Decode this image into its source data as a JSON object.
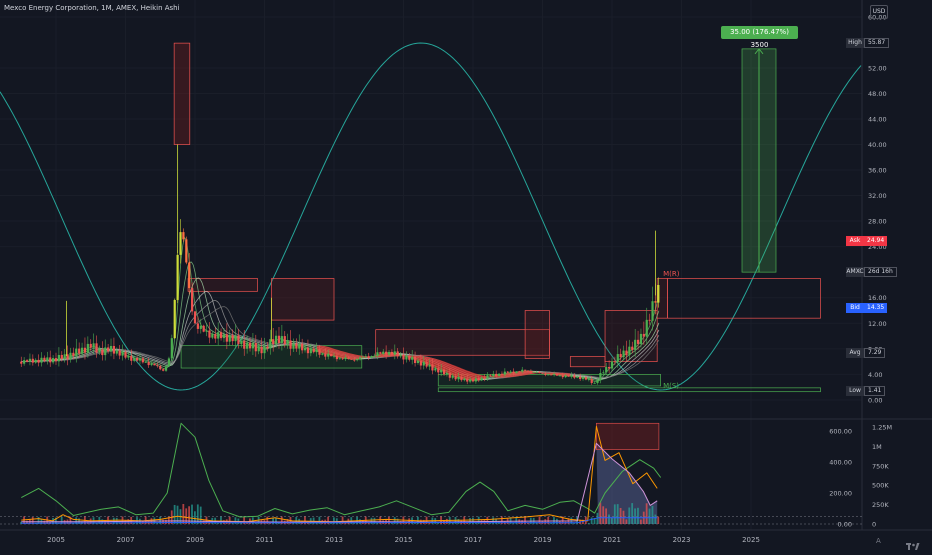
{
  "header": {
    "symbol_line": "Mexco Energy Corporation, 1M, AMEX, Heikin Ashi",
    "currency": "USD"
  },
  "price_axis": {
    "ticks": [
      {
        "label": "60.00",
        "value": 60
      },
      {
        "label": "52.00",
        "value": 52
      },
      {
        "label": "48.00",
        "value": 48
      },
      {
        "label": "44.00",
        "value": 44
      },
      {
        "label": "40.00",
        "value": 40
      },
      {
        "label": "36.00",
        "value": 36
      },
      {
        "label": "32.00",
        "value": 32
      },
      {
        "label": "28.00",
        "value": 28
      },
      {
        "label": "24.00",
        "value": 24
      },
      {
        "label": "16.00",
        "value": 16
      },
      {
        "label": "12.00",
        "value": 12
      },
      {
        "label": "8.00",
        "value": 8
      },
      {
        "label": "4.00",
        "value": 4
      },
      {
        "label": "0.00",
        "value": 0
      }
    ]
  },
  "price_tags": [
    {
      "key": "High",
      "value": "55.87",
      "price": 55.87,
      "bg": "#131722",
      "fg": "#d1d4dc",
      "keybg": "#2a2e39"
    },
    {
      "key": "Ask",
      "value": "24.94",
      "price": 24.94,
      "bg": "#f23645",
      "fg": "#ffffff",
      "keybg": "#f23645"
    },
    {
      "key": "AMXC",
      "value": "26d 16h",
      "price": 20,
      "bg": "#131722",
      "fg": "#d1d4dc",
      "keybg": "#2a2e39"
    },
    {
      "key": "Bid",
      "value": "14.35",
      "price": 14.35,
      "bg": "#2962ff",
      "fg": "#ffffff",
      "keybg": "#2962ff"
    },
    {
      "key": "Avg",
      "value": "7.29",
      "price": 7.29,
      "bg": "#131722",
      "fg": "#d1d4dc",
      "keybg": "#2a2e39"
    },
    {
      "key": "Low",
      "value": "1.41",
      "price": 1.41,
      "bg": "#131722",
      "fg": "#d1d4dc",
      "keybg": "#2a2e39"
    }
  ],
  "measure": {
    "label": "35.00 (176.47%) 3500",
    "from": 20,
    "to": 55
  },
  "annotations": [
    {
      "text": "M(R)",
      "price": 19,
      "year": 2022.7
    },
    {
      "text": "M(S)",
      "price": 1.6,
      "year": 2022.7
    }
  ],
  "indicator_axis": {
    "left_ticks": [
      {
        "label": "600.00",
        "value": 600
      },
      {
        "label": "400.00",
        "value": 400
      },
      {
        "label": "200.00",
        "value": 200
      },
      {
        "label": "0.00",
        "value": 0
      }
    ],
    "right_ticks": [
      {
        "label": "1.25M",
        "value": 1250
      },
      {
        "label": "1M",
        "value": 1000
      },
      {
        "label": "750K",
        "value": 750
      },
      {
        "label": "500K",
        "value": 500
      },
      {
        "label": "250K",
        "value": 250
      },
      {
        "label": "0",
        "value": 0
      }
    ]
  },
  "time_axis": {
    "ticks": [
      {
        "label": "2005",
        "year": 2005
      },
      {
        "label": "2007",
        "year": 2007
      },
      {
        "label": "2009",
        "year": 2009
      },
      {
        "label": "2011",
        "year": 2011
      },
      {
        "label": "2013",
        "year": 2013
      },
      {
        "label": "2015",
        "year": 2015
      },
      {
        "label": "2017",
        "year": 2017
      },
      {
        "label": "2019",
        "year": 2019
      },
      {
        "label": "2021",
        "year": 2021
      },
      {
        "label": "2023",
        "year": 2023
      },
      {
        "label": "2025",
        "year": 2025
      }
    ]
  },
  "bottom_buttons": {
    "auto": "A",
    "theme": "tradingview"
  },
  "colors": {
    "bg": "#131722",
    "up": "#26a69a",
    "down": "#ef5350",
    "green": "#4caf50",
    "grid": "#1e222d"
  },
  "chart_data": [
    {
      "type": "candlestick",
      "title": "Mexco Energy Corporation, 1M, AMEX, Heikin Ashi",
      "y_range": [
        0,
        60
      ],
      "x_range": [
        2004,
        2026
      ],
      "series": [
        {
          "points": [
            [
              2004.0,
              6.0
            ],
            [
              2004.5,
              6.2
            ],
            [
              2005.0,
              6.4
            ],
            [
              2005.5,
              7.2
            ],
            [
              2006.0,
              8.5
            ],
            [
              2006.3,
              7.5
            ],
            [
              2006.6,
              8.0
            ],
            [
              2007.0,
              6.8
            ],
            [
              2007.4,
              6.2
            ],
            [
              2007.8,
              5.5
            ],
            [
              2008.1,
              4.6
            ],
            [
              2008.3,
              7.0
            ],
            [
              2008.45,
              18.0
            ],
            [
              2008.55,
              28.0
            ],
            [
              2008.7,
              24.0
            ],
            [
              2008.85,
              16.0
            ],
            [
              2009.0,
              12.0
            ],
            [
              2009.3,
              10.5
            ],
            [
              2009.6,
              10.0
            ],
            [
              2010.0,
              9.8
            ],
            [
              2010.5,
              8.5
            ],
            [
              2011.0,
              7.8
            ],
            [
              2011.3,
              9.8
            ],
            [
              2011.6,
              9.0
            ],
            [
              2012.0,
              8.2
            ],
            [
              2012.5,
              7.5
            ],
            [
              2013.0,
              6.7
            ],
            [
              2013.5,
              6.3
            ],
            [
              2014.0,
              6.8
            ],
            [
              2014.5,
              7.5
            ],
            [
              2015.0,
              6.8
            ],
            [
              2015.5,
              5.8
            ],
            [
              2016.0,
              4.6
            ],
            [
              2016.5,
              3.4
            ],
            [
              2017.0,
              3.0
            ],
            [
              2017.5,
              3.8
            ],
            [
              2018.0,
              4.3
            ],
            [
              2018.5,
              4.6
            ],
            [
              2019.0,
              4.1
            ],
            [
              2019.5,
              3.8
            ],
            [
              2020.0,
              3.6
            ],
            [
              2020.3,
              3.2
            ],
            [
              2020.5,
              2.6
            ],
            [
              2020.7,
              4.2
            ],
            [
              2021.0,
              5.8
            ],
            [
              2021.3,
              7.3
            ],
            [
              2021.6,
              8.2
            ],
            [
              2021.9,
              10.5
            ],
            [
              2022.1,
              13.0
            ],
            [
              2022.3,
              17.5
            ]
          ],
          "highs": [
            [
              2008.5,
              40.0
            ],
            [
              2022.25,
              26.5
            ],
            [
              2005.3,
              15.5
            ],
            [
              2011.2,
              16.0
            ]
          ],
          "lows": [
            [
              2016.0,
              1.41
            ]
          ]
        }
      ],
      "ranges": [
        {
          "label": "High",
          "value": 55.87
        },
        {
          "label": "Low",
          "value": 1.41
        },
        {
          "label": "Avg",
          "value": 7.29
        }
      ]
    },
    {
      "type": "line",
      "title": "",
      "y_range": [
        0,
        660
      ],
      "x_range": [
        2004,
        2026
      ],
      "series": [
        {
          "color": "#4caf50",
          "points": [
            [
              2004.0,
              170
            ],
            [
              2004.5,
              230
            ],
            [
              2005.0,
              150
            ],
            [
              2005.5,
              55
            ],
            [
              2006.3,
              95
            ],
            [
              2006.8,
              110
            ],
            [
              2007.3,
              60
            ],
            [
              2007.8,
              70
            ],
            [
              2008.2,
              200
            ],
            [
              2008.6,
              650
            ],
            [
              2009.0,
              560
            ],
            [
              2009.4,
              280
            ],
            [
              2009.8,
              85
            ],
            [
              2010.3,
              45
            ],
            [
              2010.8,
              50
            ],
            [
              2011.3,
              100
            ],
            [
              2011.8,
              65
            ],
            [
              2012.3,
              90
            ],
            [
              2012.8,
              105
            ],
            [
              2013.3,
              60
            ],
            [
              2013.8,
              85
            ],
            [
              2014.3,
              110
            ],
            [
              2014.8,
              150
            ],
            [
              2015.3,
              105
            ],
            [
              2015.8,
              60
            ],
            [
              2016.3,
              75
            ],
            [
              2016.8,
              210
            ],
            [
              2017.2,
              270
            ],
            [
              2017.6,
              210
            ],
            [
              2018.0,
              85
            ],
            [
              2018.5,
              120
            ],
            [
              2019.0,
              95
            ],
            [
              2019.5,
              140
            ],
            [
              2019.9,
              150
            ],
            [
              2020.3,
              100
            ],
            [
              2020.5,
              70
            ],
            [
              2020.8,
              200
            ],
            [
              2021.3,
              340
            ],
            [
              2021.8,
              415
            ],
            [
              2022.2,
              360
            ],
            [
              2022.4,
              300
            ]
          ]
        },
        {
          "color": "#ff9800",
          "points": [
            [
              2004.0,
              25
            ],
            [
              2004.5,
              35
            ],
            [
              2004.9,
              20
            ],
            [
              2005.2,
              60
            ],
            [
              2005.5,
              30
            ],
            [
              2006.0,
              20
            ],
            [
              2006.8,
              25
            ],
            [
              2007.5,
              20
            ],
            [
              2008.0,
              30
            ],
            [
              2008.5,
              50
            ],
            [
              2009.0,
              35
            ],
            [
              2009.5,
              20
            ],
            [
              2010.5,
              15
            ],
            [
              2011.3,
              40
            ],
            [
              2011.8,
              20
            ],
            [
              2013.0,
              15
            ],
            [
              2014.5,
              30
            ],
            [
              2015.5,
              20
            ],
            [
              2016.8,
              25
            ],
            [
              2017.5,
              30
            ],
            [
              2018.5,
              45
            ],
            [
              2019.2,
              60
            ],
            [
              2019.8,
              30
            ],
            [
              2020.3,
              20
            ],
            [
              2020.55,
              630
            ],
            [
              2020.8,
              410
            ],
            [
              2021.2,
              460
            ],
            [
              2021.6,
              260
            ],
            [
              2022.0,
              330
            ],
            [
              2022.3,
              230
            ]
          ]
        },
        {
          "color": "#ce93d8",
          "points": [
            [
              2004.0,
              15
            ],
            [
              2006.0,
              15
            ],
            [
              2008.5,
              20
            ],
            [
              2010.0,
              15
            ],
            [
              2012.0,
              12
            ],
            [
              2014.0,
              15
            ],
            [
              2016.0,
              12
            ],
            [
              2018.0,
              18
            ],
            [
              2020.0,
              20
            ],
            [
              2020.55,
              520
            ],
            [
              2021.0,
              420
            ],
            [
              2021.5,
              330
            ],
            [
              2021.9,
              210
            ],
            [
              2022.1,
              120
            ],
            [
              2022.3,
              150
            ]
          ]
        },
        {
          "color": "#2962ff",
          "points": [
            [
              2004.0,
              5
            ],
            [
              2008.5,
              10
            ],
            [
              2012.0,
              8
            ],
            [
              2016.0,
              10
            ],
            [
              2020.0,
              8
            ],
            [
              2020.6,
              40
            ],
            [
              2022.3,
              40
            ]
          ]
        }
      ]
    }
  ]
}
